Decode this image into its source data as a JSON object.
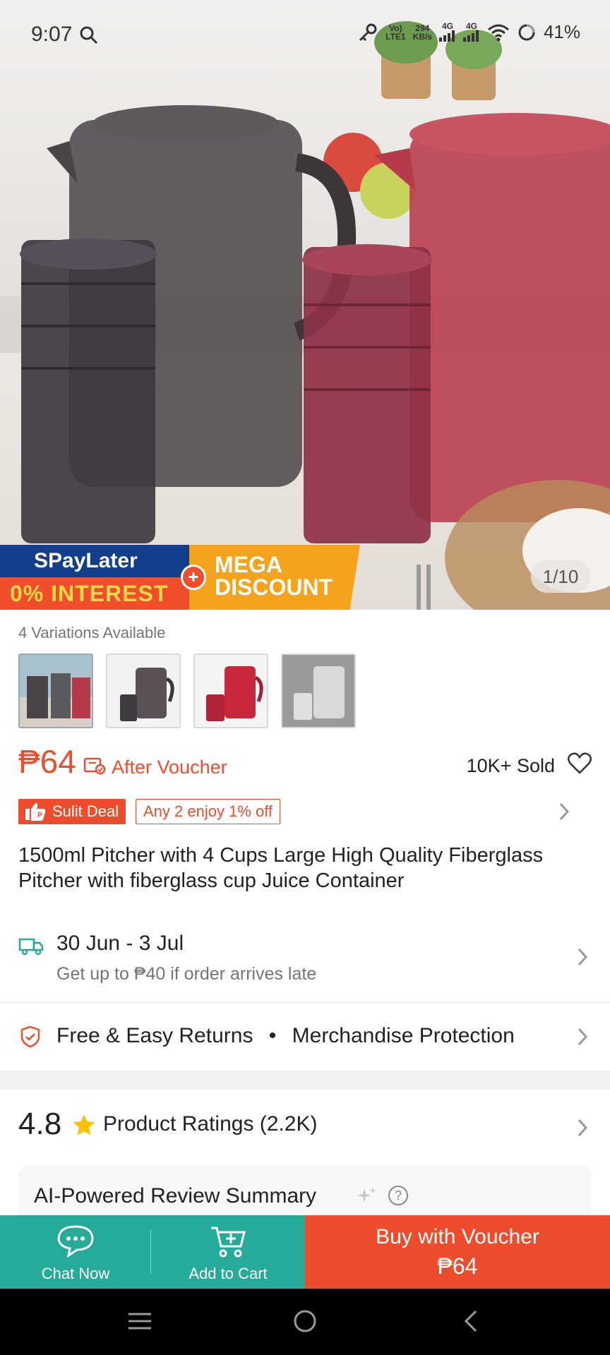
{
  "status_bar": {
    "time": "9:07",
    "volte": "Vo)",
    "lte": "LTE1",
    "speed_value": "294",
    "speed_unit": "KB/s",
    "net1": "4G",
    "net2": "4G",
    "battery": "41%"
  },
  "hero": {
    "banner_spaylater": "SPayLater",
    "banner_interest": "0% INTEREST",
    "banner_mega_line1": "MEGA",
    "banner_mega_line2": "DISCOUNT",
    "image_counter": "1/10"
  },
  "product": {
    "variations_label": "4 Variations Available",
    "price": "₱64",
    "after_voucher": "After Voucher",
    "sold": "10K+ Sold",
    "sulit_deal": "Sulit Deal",
    "bundle_offer": "Any 2 enjoy 1% off",
    "title": "1500ml Pitcher with 4 Cups Large High Quality Fiberglass Pitcher with fiberglass cup Juice Container"
  },
  "shipping": {
    "date_range": "30 Jun - 3 Jul",
    "late_guarantee": "Get up to ₱40 if order arrives late"
  },
  "protection": {
    "returns": "Free & Easy Returns",
    "bullet": "•",
    "merchandise": "Merchandise Protection"
  },
  "ratings": {
    "score": "4.8",
    "label": "Product Ratings (2.2K)",
    "ai_summary": "AI-Powered Review Summary",
    "help_mark": "?"
  },
  "actions": {
    "chat": "Chat Now",
    "add_to_cart": "Add to Cart",
    "buy_line1": "Buy with Voucher",
    "buy_line2": "₱64"
  },
  "colors": {
    "brand_orange": "#ee4d2d",
    "teal": "#26aa99"
  },
  "icons": [
    "search-icon",
    "key-icon",
    "signal-icon",
    "wifi-icon",
    "battery-icon",
    "voucher-icon",
    "heart-icon",
    "chevron-right-icon",
    "truck-icon",
    "shield-icon",
    "star-icon",
    "sparkle-icon",
    "help-icon",
    "chat-icon",
    "cart-add-icon",
    "menu-icon",
    "home-icon",
    "back-icon"
  ]
}
